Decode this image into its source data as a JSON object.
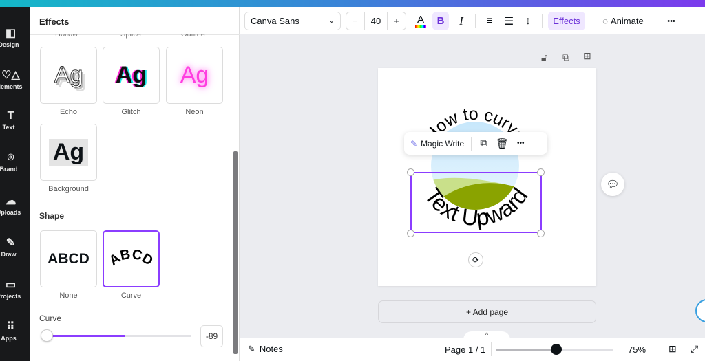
{
  "rail": {
    "items": [
      {
        "label": "Design",
        "icon": "design-icon",
        "glyph": "◧"
      },
      {
        "label": "Elements",
        "icon": "elements-icon",
        "glyph": "♡△"
      },
      {
        "label": "Text",
        "icon": "text-icon",
        "glyph": "T"
      },
      {
        "label": "Brand",
        "icon": "brand-icon",
        "glyph": "⌾"
      },
      {
        "label": "Uploads",
        "icon": "uploads-icon",
        "glyph": "☁"
      },
      {
        "label": "Draw",
        "icon": "draw-icon",
        "glyph": "✎"
      },
      {
        "label": "Projects",
        "icon": "projects-icon",
        "glyph": "▭"
      },
      {
        "label": "Apps",
        "icon": "apps-icon",
        "glyph": "⠿"
      }
    ]
  },
  "panel": {
    "title": "Effects",
    "cut_labels": [
      "Hollow",
      "Splice",
      "Outline"
    ],
    "effects": [
      {
        "label": "Echo",
        "sample": "Ag"
      },
      {
        "label": "Glitch",
        "sample": "Ag"
      },
      {
        "label": "Neon",
        "sample": "Ag"
      },
      {
        "label": "Background",
        "sample": "Ag"
      }
    ],
    "shape_title": "Shape",
    "shapes": [
      {
        "label": "None",
        "sample": "ABCD"
      },
      {
        "label": "Curve",
        "sample": "ABCD",
        "selected": true
      }
    ],
    "curve_label": "Curve",
    "curve_value": "-89",
    "curve_slider_percent": 5
  },
  "toolbar": {
    "font": "Canva Sans",
    "font_size": "40",
    "minus": "−",
    "plus": "+",
    "color_letter": "A",
    "bold": "B",
    "italic": "I",
    "effects": "Effects",
    "animate": "Animate",
    "more": "•••"
  },
  "canvas": {
    "curve_top": "How to curve",
    "curve_bottom": "Text Upward",
    "magic_write": "Magic Write",
    "more": "•••",
    "add_page": "+ Add page"
  },
  "bottom": {
    "notes": "Notes",
    "page": "Page 1 / 1",
    "zoom": "75%",
    "zoom_slider_percent": 52
  },
  "colors": {
    "accent": "#8b3dff",
    "rail": "#18191b",
    "canvas_bg": "#ebecf0"
  }
}
